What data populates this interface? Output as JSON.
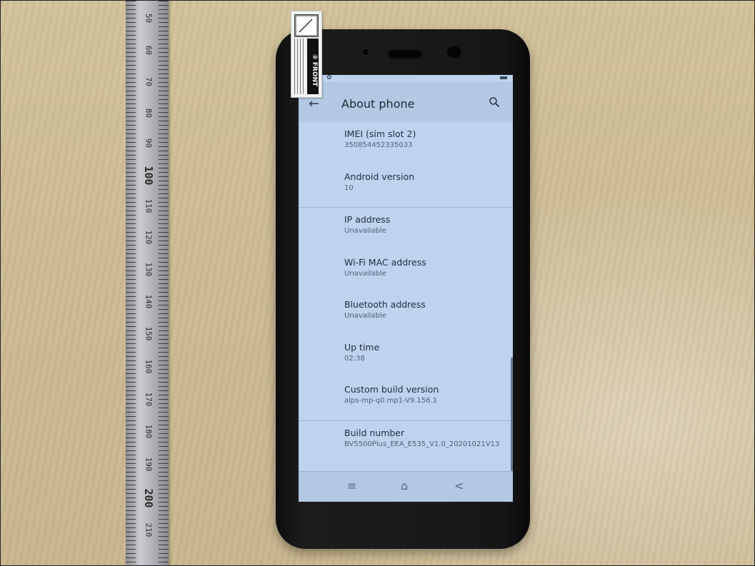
{
  "screen": {
    "title": "About phone",
    "items": [
      {
        "label": "IMEI (sim slot 2)",
        "value": "350854452335033"
      },
      {
        "label": "Android version",
        "value": "10"
      },
      {
        "label": "IP address",
        "value": "Unavailable"
      },
      {
        "label": "Wi-Fi MAC address",
        "value": "Unavailable"
      },
      {
        "label": "Bluetooth address",
        "value": "Unavailable"
      },
      {
        "label": "Up time",
        "value": "02:38"
      },
      {
        "label": "Custom build version",
        "value": "alps-mp-q0.mp1-V9.156.1"
      },
      {
        "label": "Build number",
        "value": "BV5500Plus_EEA_E535_V1.0_20201021V13"
      }
    ],
    "nav": {
      "menu_icon": "≡",
      "home_icon": "⌂",
      "back_icon": "<"
    },
    "icons": [
      "back-arrow-icon",
      "search-icon",
      "settings-gear-icon",
      "battery-icon"
    ]
  },
  "sticker": {
    "text": "② FRONT"
  },
  "ruler": {
    "labels": [
      "50",
      "60",
      "70",
      "80",
      "90",
      "100",
      "110",
      "120",
      "130",
      "140",
      "150",
      "160",
      "170",
      "180",
      "190",
      "200",
      "210"
    ]
  }
}
